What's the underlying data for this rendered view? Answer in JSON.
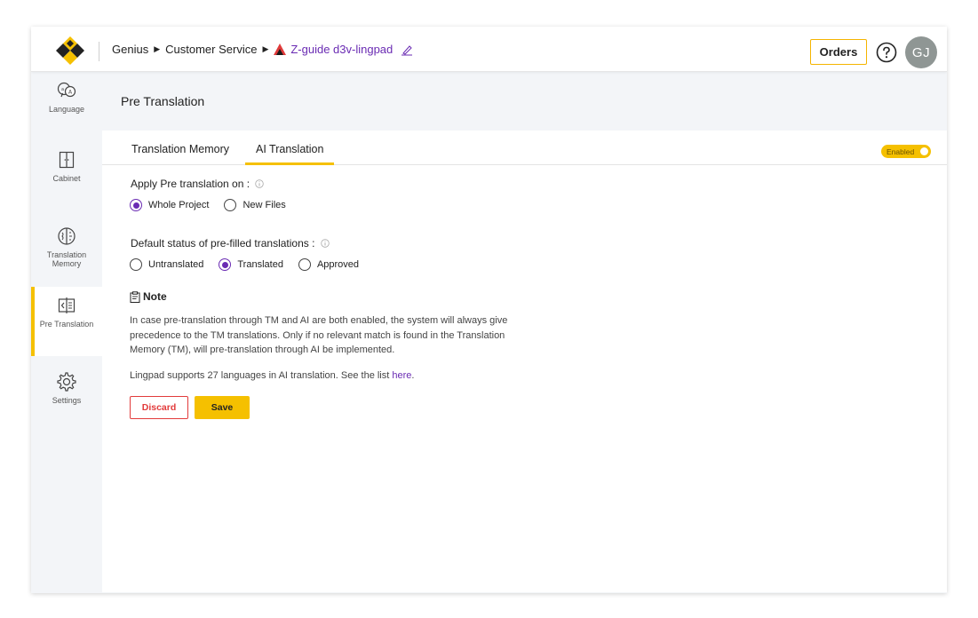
{
  "header": {
    "breadcrumb": [
      "Genius",
      "Customer Service"
    ],
    "project_name": "Z-guide d3v-lingpad",
    "orders_label": "Orders",
    "avatar_initials": "GJ"
  },
  "sidebar": {
    "items": [
      {
        "label": "Language",
        "icon": "language-icon"
      },
      {
        "label": "Cabinet",
        "icon": "cabinet-icon"
      },
      {
        "label": "Translation Memory",
        "icon": "translation-memory-icon"
      },
      {
        "label": "Pre Translation",
        "icon": "pre-translation-icon",
        "active": true
      },
      {
        "label": "Settings",
        "icon": "gear-icon"
      }
    ]
  },
  "page": {
    "title": "Pre Translation",
    "tabs": [
      {
        "label": "Translation Memory",
        "active": false
      },
      {
        "label": "AI Translation",
        "active": true
      }
    ],
    "enabled_badge": "Enabled",
    "apply_on": {
      "label": "Apply Pre translation on :",
      "options": [
        {
          "label": "Whole Project",
          "selected": true
        },
        {
          "label": "New Files",
          "selected": false
        }
      ]
    },
    "default_status": {
      "label": "Default status of pre-filled translations :",
      "options": [
        {
          "label": "Untranslated",
          "selected": false
        },
        {
          "label": "Translated",
          "selected": true
        },
        {
          "label": "Approved",
          "selected": false
        }
      ]
    },
    "note": {
      "title": "Note",
      "text": "In case pre-translation through TM and AI are both enabled, the system will always give precedence to the TM translations. Only if no relevant match is found in the Translation Memory (TM), will pre-translation through AI be implemented."
    },
    "support_text": "Lingpad supports 27 languages in AI translation. See the list",
    "support_link": "here",
    "support_suffix": ".",
    "discard_label": "Discard",
    "save_label": "Save"
  },
  "colors": {
    "accent": "#f5c000",
    "brand_purple": "#6a2bb3",
    "danger": "#e23b3b"
  }
}
